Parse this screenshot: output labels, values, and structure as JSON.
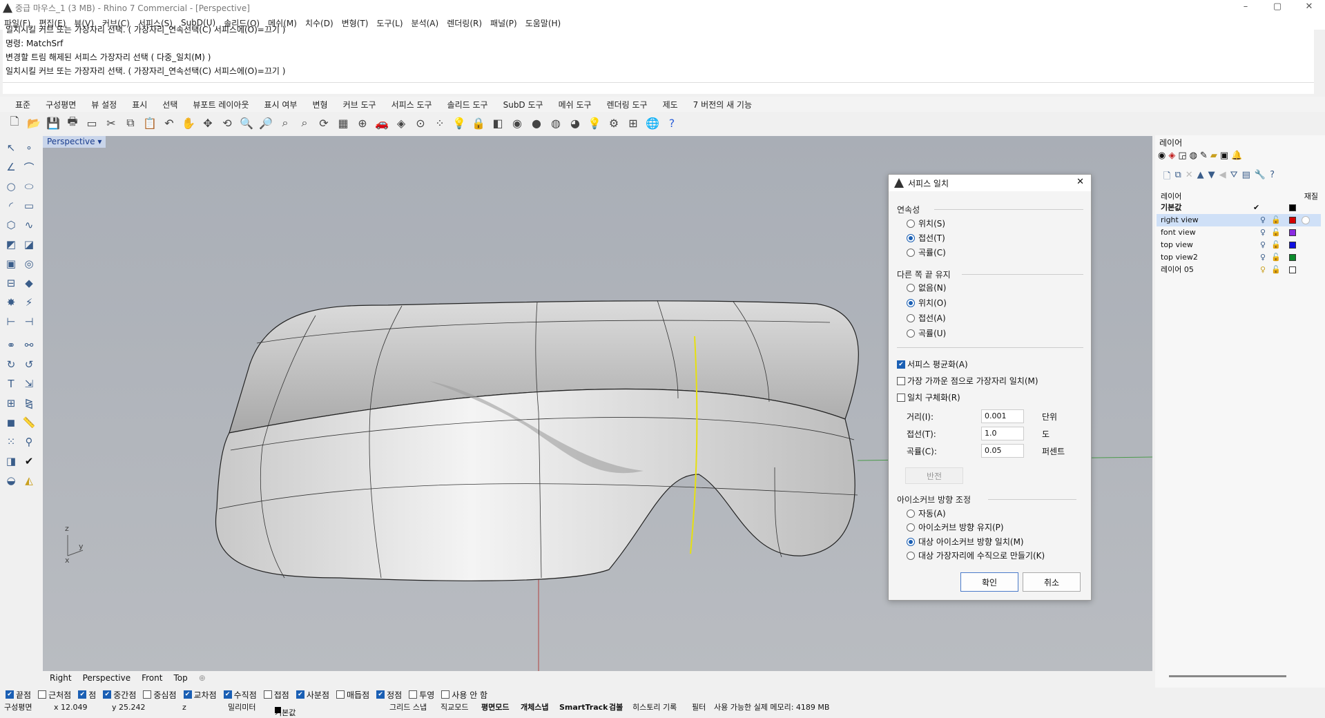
{
  "window": {
    "title": "중급 마우스_1 (3 MB) - Rhino 7 Commercial - [Perspective]",
    "min": "–",
    "max": "▢",
    "close": "✕"
  },
  "menu": [
    "파일(F)",
    "편집(E)",
    "뷰(V)",
    "커브(C)",
    "서피스(S)",
    "SubD(U)",
    "솔리드(O)",
    "메쉬(M)",
    "치수(D)",
    "변형(T)",
    "도구(L)",
    "분석(A)",
    "렌더링(R)",
    "패널(P)",
    "도움말(H)"
  ],
  "command_history": [
    "일치시킬 커브 또는 가장자리 선택. ( 가장자리_연속선택(C)  서피스에(O)=끄기 )",
    "명령: MatchSrf",
    "변경할 트림 해제된 서피스 가장자리 선택 ( 다중_일치(M) )",
    "일치시킬 커브 또는 가장자리 선택. ( 가장자리_연속선택(C)  서피스에(O)=끄기 )"
  ],
  "tabs": [
    "표준",
    "구성평면",
    "뷰 설정",
    "표시",
    "선택",
    "뷰포트 레이아웃",
    "표시 여부",
    "변형",
    "커브 도구",
    "서피스 도구",
    "솔리드 도구",
    "SubD 도구",
    "메쉬 도구",
    "렌더링 도구",
    "제도",
    "7 버전의 새 기능"
  ],
  "viewport": {
    "label": "Perspective",
    "axis_z": "z",
    "axis_y": "y",
    "axis_x": "x"
  },
  "viewport_tabs": [
    "Right",
    "Perspective",
    "Front",
    "Top"
  ],
  "snaps": [
    {
      "label": "끝점",
      "on": true
    },
    {
      "label": "근처점",
      "on": false
    },
    {
      "label": "점",
      "on": true
    },
    {
      "label": "중간점",
      "on": true
    },
    {
      "label": "중심점",
      "on": false
    },
    {
      "label": "교차점",
      "on": true
    },
    {
      "label": "수직점",
      "on": true
    },
    {
      "label": "접점",
      "on": false
    },
    {
      "label": "사분점",
      "on": true
    },
    {
      "label": "매듭점",
      "on": false
    },
    {
      "label": "정점",
      "on": true
    },
    {
      "label": "투영",
      "on": false
    },
    {
      "label": "사용 안 함",
      "on": false
    }
  ],
  "status": {
    "cplane": "구성평면",
    "x": "x 12.049",
    "y": "y 25.242",
    "z": "z",
    "unit": "밀리미터",
    "layer": "기본값",
    "grid": "그리드 스냅",
    "ortho": "직교모드",
    "planar": "평면모드",
    "osnap": "개체스냅",
    "smarttrack": "SmartTrack",
    "gumball": "검볼",
    "history": "히스토리 기록",
    "filter": "필터",
    "memory": "사용 가능한 실제 메모리: 4189 MB"
  },
  "layers": {
    "panel_title": "레이어",
    "col_name": "레이어",
    "col_material": "재질",
    "rows": [
      {
        "name": "기본값",
        "bold": true,
        "color": "#000000"
      },
      {
        "name": "right view",
        "selected": true,
        "color": "#d40000"
      },
      {
        "name": "font view",
        "color": "#8a2be2"
      },
      {
        "name": "top view",
        "color": "#1010e0"
      },
      {
        "name": "top view2",
        "color": "#0a8a2a"
      },
      {
        "name": "레이어 05",
        "color": "#ffffff"
      }
    ]
  },
  "dialog": {
    "title": "서피스 일치",
    "continuity_label": "연속성",
    "continuity": [
      "위치(S)",
      "접선(T)",
      "곡률(C)"
    ],
    "continuity_selected": 1,
    "preserve_label": "다른 쪽 끝 유지",
    "preserve": [
      "없음(N)",
      "위치(O)",
      "접선(A)",
      "곡률(U)"
    ],
    "preserve_selected": 1,
    "check_average": "서피스 평균화(A)",
    "check_closest": "가장 가까운 점으로 가장자리 일치(M)",
    "check_refine": "일치 구체화(R)",
    "dist_label": "거리(I):",
    "dist_value": "0.001",
    "dist_unit": "단위",
    "tan_label": "접선(T):",
    "tan_value": "1.0",
    "tan_unit": "도",
    "curv_label": "곡률(C):",
    "curv_value": "0.05",
    "curv_unit": "퍼센트",
    "flip": "반전",
    "iso_label": "아이소커브 방향 조정",
    "iso": [
      "자동(A)",
      "아이소커브 방향 유지(P)",
      "대상 아이소커브 방향 일치(M)",
      "대상 가장자리에 수직으로 만들기(K)"
    ],
    "iso_selected": 2,
    "ok": "확인",
    "cancel": "취소"
  }
}
